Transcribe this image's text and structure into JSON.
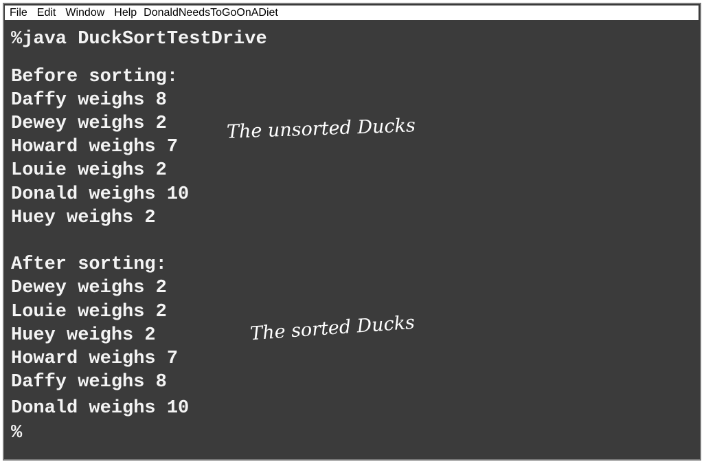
{
  "menubar": {
    "items": [
      "File",
      "Edit",
      "Window",
      "Help"
    ],
    "title": "DonaldNeedsToGoOnADiet"
  },
  "terminal": {
    "command": "%java DuckSortTestDrive",
    "before_heading": "Before sorting:",
    "before_lines": [
      "Daffy weighs 8",
      "Dewey weighs 2",
      "Howard weighs 7",
      "Louie weighs 2",
      "Donald weighs 10",
      "Huey weighs 2"
    ],
    "after_heading": "After sorting:",
    "after_lines": [
      "Dewey weighs 2",
      "Louie weighs 2",
      "Huey weighs 2",
      "Howard weighs 7",
      "Daffy weighs 8",
      "Donald weighs 10"
    ],
    "prompt": "%"
  },
  "annotations": {
    "unsorted": "The unsorted Ducks",
    "sorted": "The sorted Ducks"
  },
  "colors": {
    "terminal_bg": "#3b3b3b",
    "text": "#f4f4f4"
  }
}
